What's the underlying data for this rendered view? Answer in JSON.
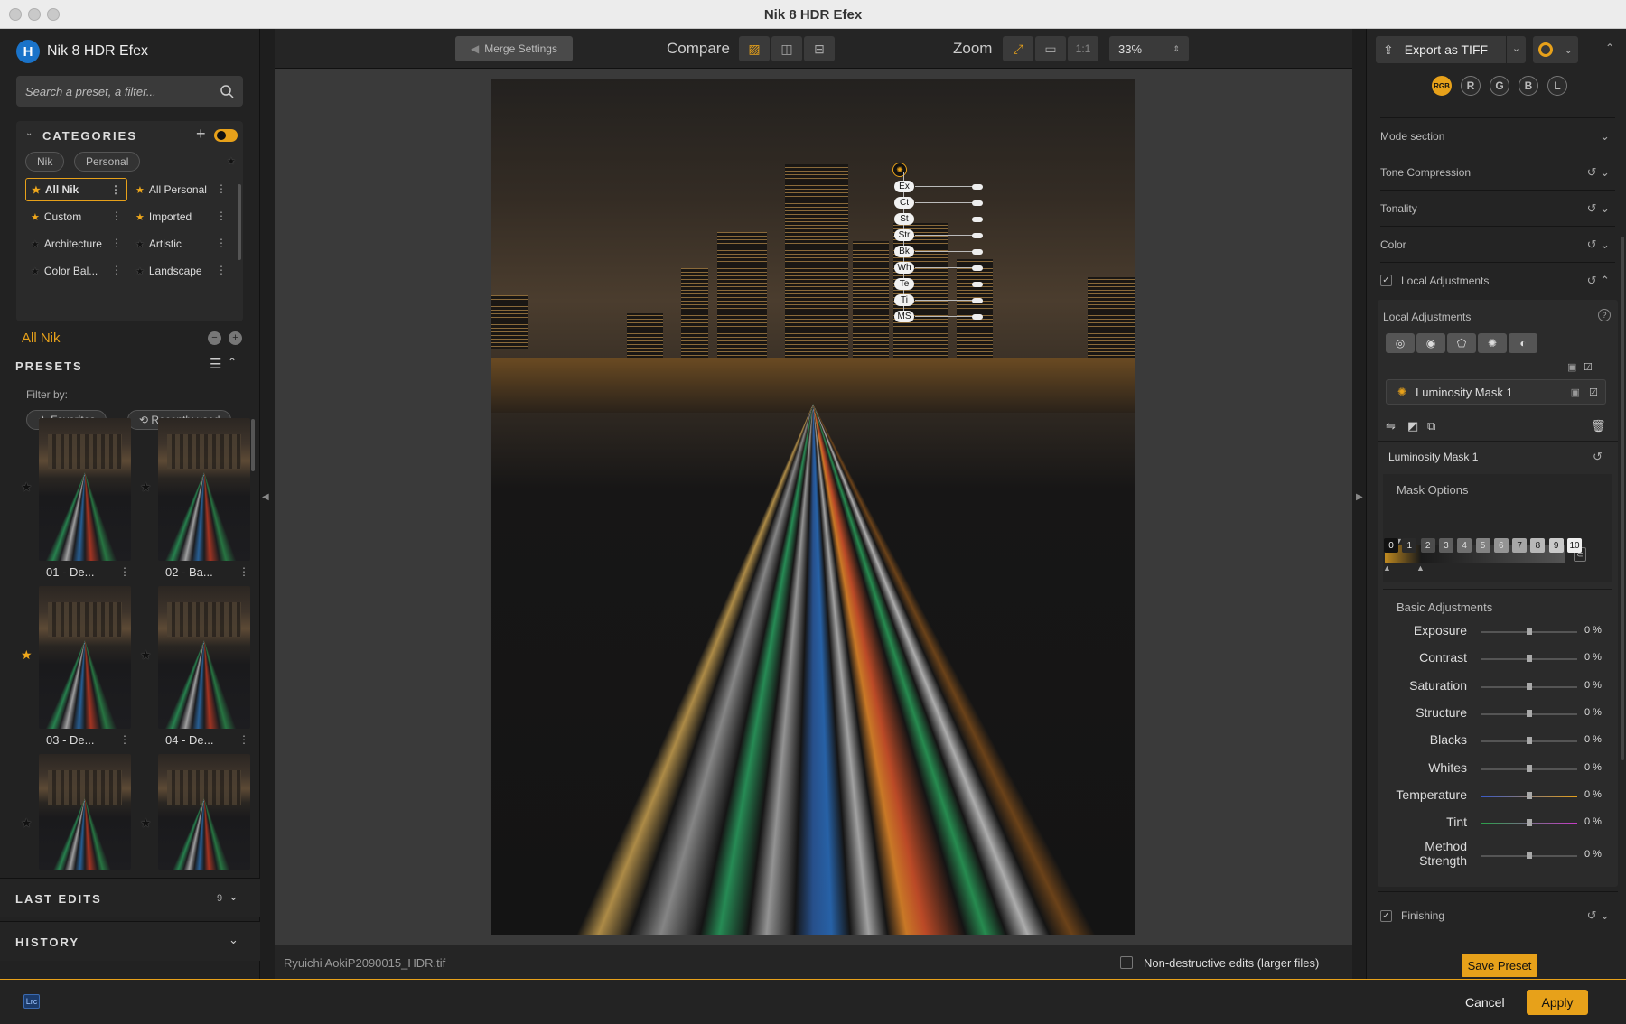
{
  "window": {
    "title": "Nik 8 HDR Efex"
  },
  "left": {
    "brand": "Nik 8 HDR Efex",
    "search_placeholder": "Search a preset, a filter...",
    "categories_title": "CATEGORIES",
    "pills": [
      "Nik",
      "Personal"
    ],
    "categories": [
      {
        "label": "All Nik",
        "star": "gold",
        "active": true
      },
      {
        "label": "All Personal",
        "star": "gold"
      },
      {
        "label": "Custom",
        "star": "gold"
      },
      {
        "label": "Imported",
        "star": "gold"
      },
      {
        "label": "Architecture",
        "star": "dark"
      },
      {
        "label": "Artistic",
        "star": "dark"
      },
      {
        "label": "Color Bal...",
        "star": "dark"
      },
      {
        "label": "Landscape",
        "star": "dark"
      }
    ],
    "current_category": "All Nik",
    "presets_title": "PRESETS",
    "filter_by": "Filter by:",
    "filters": [
      "★ Favorites",
      "⟲ Recently used"
    ],
    "presets": [
      {
        "label": "01 - De...",
        "star": "dark"
      },
      {
        "label": "02 - Ba...",
        "star": "dark"
      },
      {
        "label": "03 - De...",
        "star": "gold"
      },
      {
        "label": "04 - De...",
        "star": "dark"
      },
      {
        "label": "",
        "star": "dark"
      },
      {
        "label": "",
        "star": "dark"
      }
    ],
    "last_edits": "LAST EDITS",
    "last_edits_count": "9",
    "history": "HISTORY"
  },
  "toolbar": {
    "merge_settings": "Merge Settings",
    "compare": "Compare",
    "zoom": "Zoom",
    "one_to_one": "1:1",
    "zoom_value": "33%"
  },
  "overlay_nodes": [
    "Ex",
    "Ct",
    "St",
    "Str",
    "Bk",
    "Wh",
    "Te",
    "Ti",
    "MS"
  ],
  "status": {
    "filename": "Ryuichi AokiP2090015_HDR.tif",
    "non_destructive": "Non-destructive edits (larger files)"
  },
  "right": {
    "export": "Export as TIFF",
    "channels": [
      "RGB",
      "R",
      "G",
      "B",
      "L"
    ],
    "sections": [
      "Mode section",
      "Tone Compression",
      "Tonality",
      "Color"
    ],
    "local_adjustments": "Local Adjustments",
    "local_adjustments_sub": "Local Adjustments",
    "mask_item": "Luminosity Mask 1",
    "mask_name": "Luminosity Mask 1",
    "mask_options": "Mask Options",
    "mask_levels": [
      "0",
      "1",
      "2",
      "3",
      "4",
      "5",
      "6",
      "7",
      "8",
      "9",
      "10"
    ],
    "basic_adjustments": "Basic Adjustments",
    "adjustments": [
      {
        "label": "Exposure",
        "value": "0 %"
      },
      {
        "label": "Contrast",
        "value": "0 %"
      },
      {
        "label": "Saturation",
        "value": "0 %"
      },
      {
        "label": "Structure",
        "value": "0 %"
      },
      {
        "label": "Blacks",
        "value": "0 %"
      },
      {
        "label": "Whites",
        "value": "0 %"
      },
      {
        "label": "Temperature",
        "value": "0 %"
      },
      {
        "label": "Tint",
        "value": "0 %"
      },
      {
        "label": "Method Strength",
        "value": "0 %"
      }
    ],
    "finishing": "Finishing",
    "save_preset": "Save Preset"
  },
  "footer": {
    "lrc": "Lrc",
    "cancel": "Cancel",
    "apply": "Apply"
  },
  "colors": {
    "accent": "#e7a11a",
    "panel": "#242424",
    "canvas": "#3a3a3a"
  }
}
